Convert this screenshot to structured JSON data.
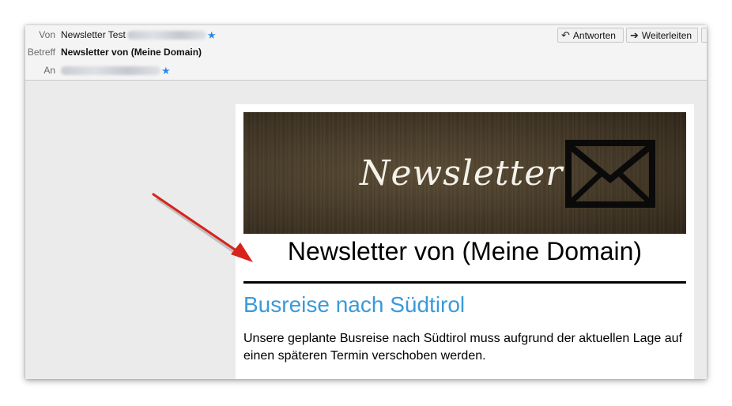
{
  "header": {
    "from_label": "Von",
    "from_value": "Newsletter Test",
    "subject_label": "Betreff",
    "subject_value": "Newsletter von (Meine Domain)",
    "to_label": "An"
  },
  "actions": {
    "reply_label": "Antworten",
    "forward_label": "Weiterleiten"
  },
  "email": {
    "banner_text": "Newsletter",
    "newsletter_title": "Newsletter von (Meine Domain)",
    "article_title": "Busreise nach Südtirol",
    "article_body": "Unsere geplante Busreise nach Südtirol muss aufgrund der aktuellen Lage auf einen späteren Termin verschoben werden."
  },
  "colors": {
    "accent_blue": "#3a9ad9",
    "star_blue": "#2b8ae8",
    "annotation_arrow": "#d8231c"
  }
}
